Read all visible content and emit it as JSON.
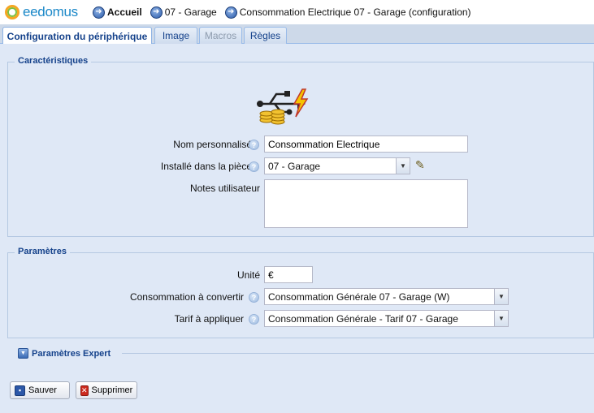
{
  "header": {
    "logo_text": "eedomus",
    "breadcrumbs": [
      {
        "label": "Accueil"
      },
      {
        "label": "07 - Garage"
      },
      {
        "label": "Consommation Electrique 07 - Garage (configuration)"
      }
    ]
  },
  "tabs": [
    {
      "label": "Configuration du périphérique",
      "state": "active"
    },
    {
      "label": "Image",
      "state": "normal"
    },
    {
      "label": "Macros",
      "state": "disabled"
    },
    {
      "label": "Règles",
      "state": "normal"
    }
  ],
  "characteristics": {
    "legend": "Caractéristiques",
    "name_label": "Nom personnalisé",
    "name_value": "Consommation Electrique",
    "room_label": "Installé dans la pièce",
    "room_value": "07 - Garage",
    "notes_label": "Notes utilisateur",
    "notes_value": ""
  },
  "parameters": {
    "legend": "Paramètres",
    "unit_label": "Unité",
    "unit_value": "€",
    "conso_label": "Consommation à convertir",
    "conso_value": "Consommation Générale 07 - Garage (W)",
    "tarif_label": "Tarif à appliquer",
    "tarif_value": "Consommation Générale - Tarif 07 - Garage"
  },
  "expert": {
    "label": "Paramètres Expert"
  },
  "actions": {
    "save_label": "Sauver",
    "delete_label": "Supprimer"
  },
  "help_glyph": "?",
  "colors": {
    "accent": "#15428b",
    "panel": "#dfe8f6",
    "logo_blue": "#1b88c8"
  }
}
